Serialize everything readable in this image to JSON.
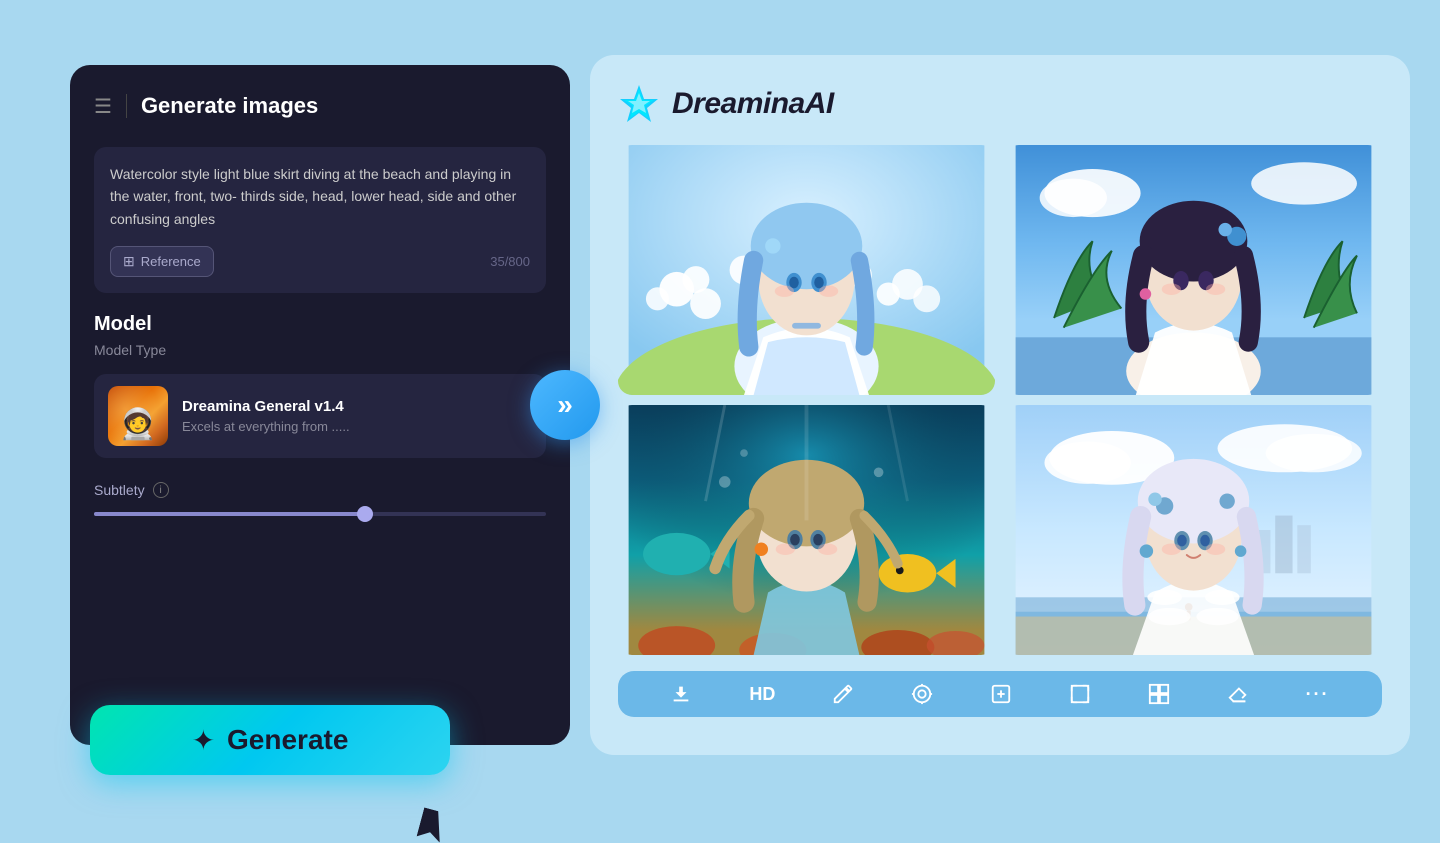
{
  "app": {
    "title": "DreaminaAI",
    "logo_alt": "dreamina-logo"
  },
  "left_panel": {
    "header": {
      "menu_icon": "☰",
      "divider": true,
      "title": "Generate images"
    },
    "prompt": {
      "text": "Watercolor style light blue skirt diving at the beach and playing in the water, front, two- thirds side, head, lower head, side and other confusing angles",
      "char_count": "35/800",
      "reference_btn": "Reference"
    },
    "model": {
      "section_title": "Model",
      "section_subtitle": "Model Type",
      "name": "Dreamina General v1.4",
      "description": "Excels at everything from .....",
      "thumbnail_emoji": "🧑‍🚀"
    },
    "subtlety": {
      "label": "Subtlety",
      "slider_value": 60
    },
    "generate_btn": "Generate",
    "generate_icon": "✦"
  },
  "toolbar": {
    "items": [
      {
        "id": "download",
        "icon": "⬇",
        "label": "download-icon"
      },
      {
        "id": "hd",
        "text": "HD",
        "label": "hd-button"
      },
      {
        "id": "brush",
        "icon": "✏",
        "label": "brush-icon"
      },
      {
        "id": "magic",
        "icon": "◎",
        "label": "magic-icon"
      },
      {
        "id": "add",
        "icon": "⊕",
        "label": "add-image-icon"
      },
      {
        "id": "crop",
        "icon": "⊡",
        "label": "crop-icon"
      },
      {
        "id": "resize",
        "icon": "⊞",
        "label": "resize-icon"
      },
      {
        "id": "erase",
        "icon": "⌫",
        "label": "erase-icon"
      },
      {
        "id": "more",
        "icon": "•••",
        "label": "more-icon"
      }
    ]
  },
  "images": [
    {
      "id": "img1",
      "alt": "Blue hair anime girl with white flowers"
    },
    {
      "id": "img2",
      "alt": "Dark hair anime girl at tropical beach"
    },
    {
      "id": "img3",
      "alt": "Underwater anime character diving"
    },
    {
      "id": "img4",
      "alt": "White hair anime girl at seaside"
    }
  ]
}
